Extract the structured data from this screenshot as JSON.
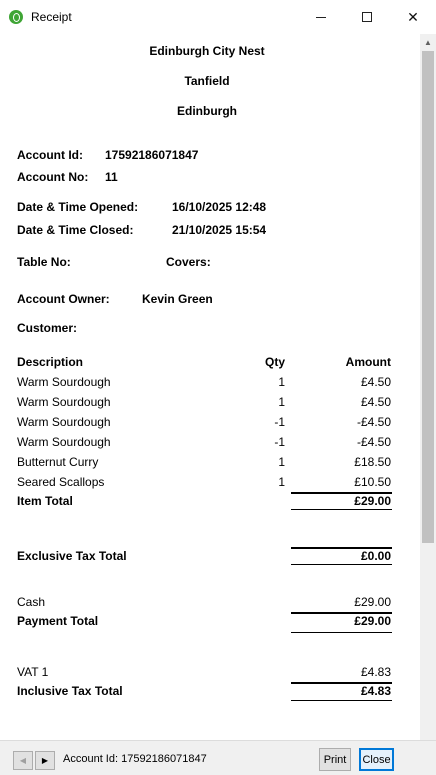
{
  "window": {
    "title": "Receipt"
  },
  "header": {
    "business": "Edinburgh City Nest",
    "area": "Tanfield",
    "city": "Edinburgh"
  },
  "account": {
    "id_label": "Account Id:",
    "id_value": "17592186071847",
    "no_label": "Account No:",
    "no_value": "11",
    "opened_label": "Date & Time Opened:",
    "opened_value": "16/10/2025 12:48",
    "closed_label": "Date & Time Closed:",
    "closed_value": "21/10/2025 15:54",
    "table_label": "Table No:",
    "covers_label": "Covers:",
    "owner_label": "Account Owner:",
    "owner_value": "Kevin Green",
    "customer_label": "Customer:"
  },
  "items": {
    "headers": {
      "description": "Description",
      "qty": "Qty",
      "amount": "Amount"
    },
    "rows": [
      {
        "description": "Warm Sourdough",
        "qty": "1",
        "amount": "£4.50"
      },
      {
        "description": "Warm Sourdough",
        "qty": "1",
        "amount": "£4.50"
      },
      {
        "description": "Warm Sourdough",
        "qty": "-1",
        "amount": "-£4.50"
      },
      {
        "description": "Warm Sourdough",
        "qty": "-1",
        "amount": "-£4.50"
      },
      {
        "description": "Butternut Curry",
        "qty": "1",
        "amount": "£18.50"
      },
      {
        "description": "Seared Scallops",
        "qty": "1",
        "amount": "£10.50"
      }
    ],
    "total_label": "Item Total",
    "total_value": "£29.00"
  },
  "exclusive_tax": {
    "label": "Exclusive Tax Total",
    "value": "£0.00"
  },
  "payments": {
    "method_label": "Cash",
    "method_value": "£29.00",
    "total_label": "Payment Total",
    "total_value": "£29.00"
  },
  "inclusive_tax": {
    "vat_label": "VAT 1",
    "vat_value": "£4.83",
    "total_label": "Inclusive Tax Total",
    "total_value": "£4.83"
  },
  "statusbar": {
    "text": "Account Id: 17592186071847",
    "print_label": "Print",
    "close_label": "Close",
    "prev_icon": "◀",
    "next_icon": "▶"
  },
  "icons": {
    "app": "receipt-app-icon",
    "minimize": "minimize-icon",
    "maximize": "maximize-icon",
    "close": "close-icon"
  },
  "colors": {
    "accent": "#0078d7",
    "app_icon": "#3fa535"
  }
}
